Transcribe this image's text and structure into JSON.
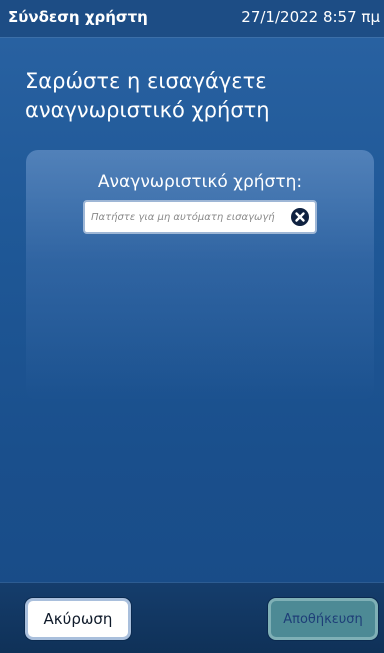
{
  "status_bar": {
    "title": "Σύνδεση χρήστη",
    "datetime": "27/1/2022 8:57 πμ"
  },
  "main": {
    "instruction": "Σαρώστε η εισαγάγετε αναγνωριστικό χρήστη",
    "field_label": "Αναγνωριστικό χρήστη:",
    "input_placeholder": "Πατήστε για μη αυτόματη εισαγωγή",
    "input_value": ""
  },
  "footer": {
    "cancel_label": "Ακύρωση",
    "save_label": "Αποθήκευση"
  },
  "icons": {
    "clear": "close-circle-icon"
  },
  "colors": {
    "background": "#1f5897",
    "status_bar": "#1d4d85",
    "save_button": "#4d8a95"
  }
}
